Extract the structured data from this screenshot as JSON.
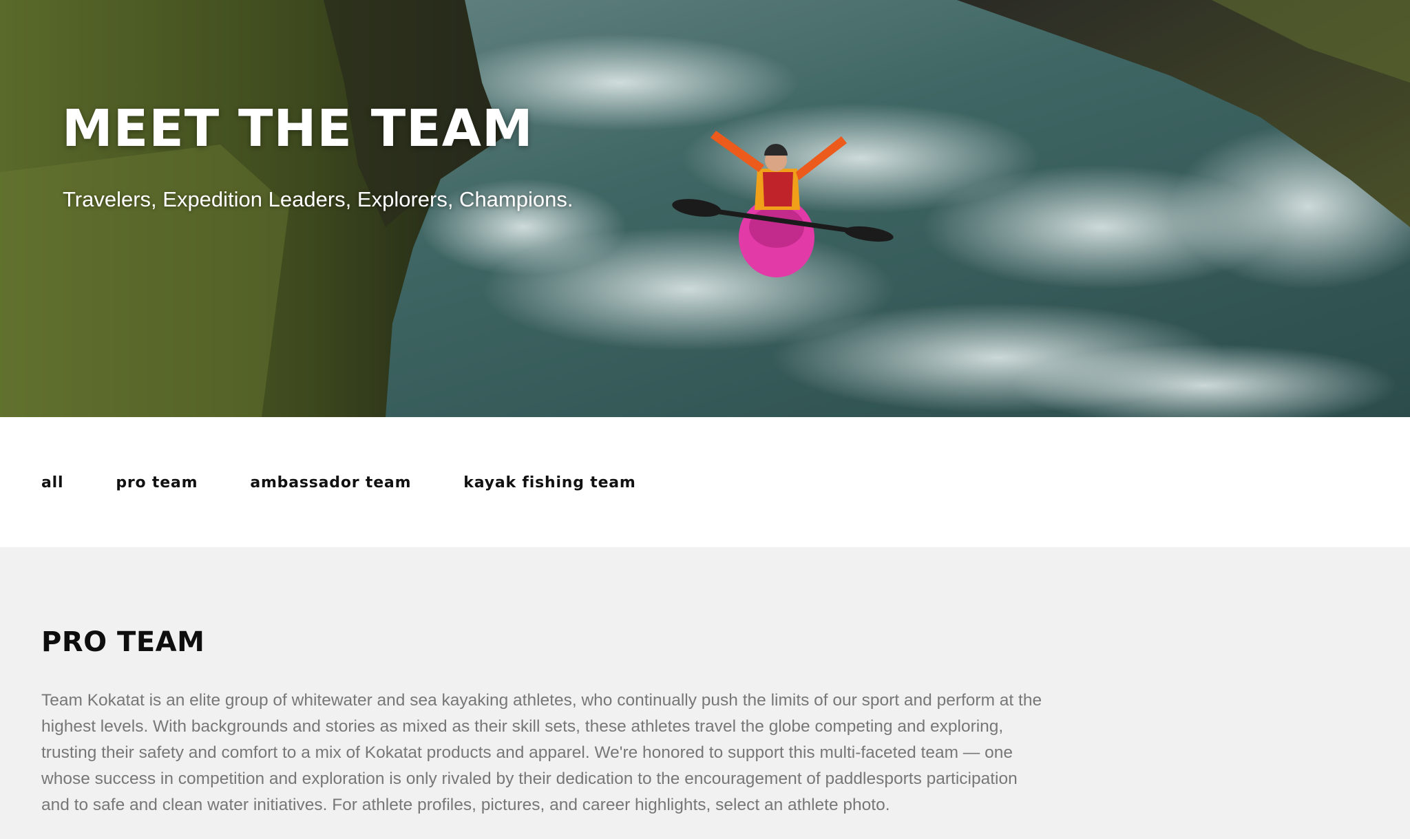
{
  "hero": {
    "title": "MEET THE TEAM",
    "subtitle": "Travelers, Expedition Leaders, Explorers, Champions."
  },
  "filters": [
    {
      "label": "all"
    },
    {
      "label": "pro team"
    },
    {
      "label": "ambassador team"
    },
    {
      "label": "kayak fishing team"
    }
  ],
  "section": {
    "title": "PRO TEAM",
    "body": "Team Kokatat is an elite group of whitewater and sea kayaking athletes, who continually push the limits of our sport and perform at the highest levels. With backgrounds and stories as mixed as their skill sets, these athletes travel the globe competing and exploring, trusting their safety and comfort to a mix of Kokatat products and apparel. We're honored to support this multi-faceted team — one whose success in competition and exploration is only rivaled by their dedication to the encouragement of paddlesports participation and to safe and clean water initiatives. For athlete profiles, pictures, and career highlights, select an athlete photo."
  }
}
